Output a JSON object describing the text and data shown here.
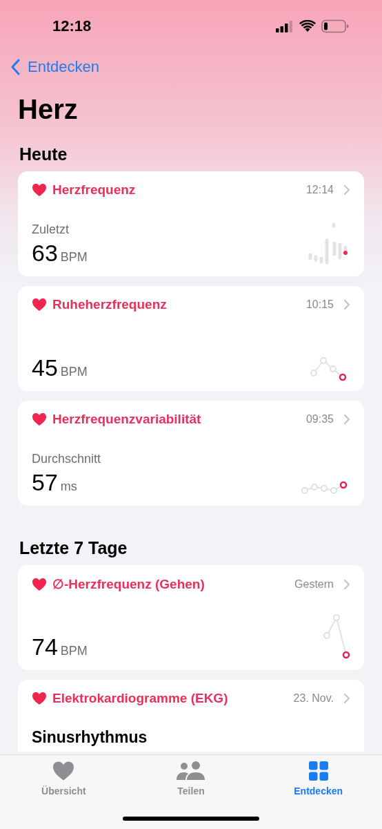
{
  "status_bar": {
    "time": "12:18"
  },
  "nav": {
    "back": "Entdecken"
  },
  "title": "Herz",
  "sections": [
    {
      "heading": "Heute",
      "cards": [
        {
          "title": "Herzfrequenz",
          "time": "12:14",
          "label": "Zuletzt",
          "value": "63",
          "unit": "BPM",
          "kind": "bars"
        },
        {
          "title": "Ruheherzfrequenz",
          "time": "10:15",
          "value": "45",
          "unit": "BPM",
          "kind": "peak"
        },
        {
          "title": "Herzfrequenzvariabilität",
          "time": "09:35",
          "label": "Durchschnitt",
          "value": "57",
          "unit": "ms",
          "kind": "flat"
        }
      ]
    },
    {
      "heading": "Letzte 7 Tage",
      "cards": [
        {
          "title": "∅-Herzfrequenz (Gehen)",
          "time": "Gestern",
          "value": "74",
          "unit": "BPM",
          "kind": "drop"
        },
        {
          "title": "Elektrokardiogramme (EKG)",
          "time": "23. Nov.",
          "result": "Sinusrhythmus"
        }
      ]
    }
  ],
  "tab_bar": [
    {
      "label": "Übersicht",
      "selected": false
    },
    {
      "label": "Teilen",
      "selected": false
    },
    {
      "label": "Entdecken",
      "selected": true
    }
  ]
}
